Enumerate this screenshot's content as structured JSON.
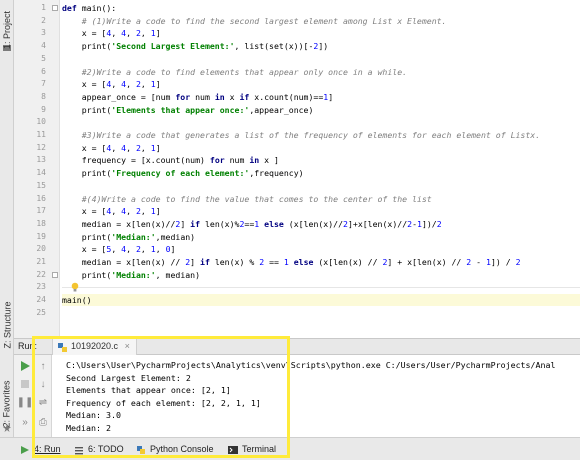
{
  "left_strip": {
    "tab_project": "1: Project",
    "tab_structure": "Z: Structure",
    "tab_favorites": "2: Favorites"
  },
  "editor": {
    "line_numbers": [
      "1",
      "2",
      "3",
      "4",
      "5",
      "6",
      "7",
      "8",
      "9",
      "10",
      "11",
      "12",
      "13",
      "14",
      "15",
      "16",
      "17",
      "18",
      "19",
      "20",
      "21",
      "22",
      "23",
      "24",
      "25"
    ],
    "lines": [
      [
        {
          "t": "def ",
          "c": "kw"
        },
        {
          "t": "main",
          "c": ""
        },
        {
          "t": "():",
          "c": ""
        }
      ],
      [
        {
          "t": "    # (1)Write a code to find the second largest element among List x Element.",
          "c": "cm"
        }
      ],
      [
        {
          "t": "    x = [",
          "c": ""
        },
        {
          "t": "4",
          "c": "num"
        },
        {
          "t": ", ",
          "c": ""
        },
        {
          "t": "4",
          "c": "num"
        },
        {
          "t": ", ",
          "c": ""
        },
        {
          "t": "2",
          "c": "num"
        },
        {
          "t": ", ",
          "c": ""
        },
        {
          "t": "1",
          "c": "num"
        },
        {
          "t": "]",
          "c": ""
        }
      ],
      [
        {
          "t": "    print(",
          "c": ""
        },
        {
          "t": "'Second Largest Element:'",
          "c": "str"
        },
        {
          "t": ", list(set(x))[-",
          "c": ""
        },
        {
          "t": "2",
          "c": "num"
        },
        {
          "t": "])",
          "c": ""
        }
      ],
      [],
      [
        {
          "t": "    #2)Write a code to find elements that appear only once in a while.",
          "c": "cm"
        }
      ],
      [
        {
          "t": "    x = [",
          "c": ""
        },
        {
          "t": "4",
          "c": "num"
        },
        {
          "t": ", ",
          "c": ""
        },
        {
          "t": "4",
          "c": "num"
        },
        {
          "t": ", ",
          "c": ""
        },
        {
          "t": "2",
          "c": "num"
        },
        {
          "t": ", ",
          "c": ""
        },
        {
          "t": "1",
          "c": "num"
        },
        {
          "t": "]",
          "c": ""
        }
      ],
      [
        {
          "t": "    appear_once = [num ",
          "c": ""
        },
        {
          "t": "for ",
          "c": "kw"
        },
        {
          "t": "num ",
          "c": ""
        },
        {
          "t": "in ",
          "c": "kw"
        },
        {
          "t": "x ",
          "c": ""
        },
        {
          "t": "if ",
          "c": "kw"
        },
        {
          "t": "x.count(num)==",
          "c": ""
        },
        {
          "t": "1",
          "c": "num"
        },
        {
          "t": "]",
          "c": ""
        }
      ],
      [
        {
          "t": "    print(",
          "c": ""
        },
        {
          "t": "'Elements that appear once:'",
          "c": "str"
        },
        {
          "t": ",appear_once)",
          "c": ""
        }
      ],
      [],
      [
        {
          "t": "    #3)Write a code that generates a list of the frequency of elements for each element of Listx.",
          "c": "cm"
        }
      ],
      [
        {
          "t": "    x = [",
          "c": ""
        },
        {
          "t": "4",
          "c": "num"
        },
        {
          "t": ", ",
          "c": ""
        },
        {
          "t": "4",
          "c": "num"
        },
        {
          "t": ", ",
          "c": ""
        },
        {
          "t": "2",
          "c": "num"
        },
        {
          "t": ", ",
          "c": ""
        },
        {
          "t": "1",
          "c": "num"
        },
        {
          "t": "]",
          "c": ""
        }
      ],
      [
        {
          "t": "    frequency = [x.count(num) ",
          "c": ""
        },
        {
          "t": "for ",
          "c": "kw"
        },
        {
          "t": "num ",
          "c": ""
        },
        {
          "t": "in ",
          "c": "kw"
        },
        {
          "t": "x ]",
          "c": ""
        }
      ],
      [
        {
          "t": "    print(",
          "c": ""
        },
        {
          "t": "'Frequency of each element:'",
          "c": "str"
        },
        {
          "t": ",frequency)",
          "c": ""
        }
      ],
      [],
      [
        {
          "t": "    #(4)Write a code to find the value that comes to the center of the list",
          "c": "cm"
        }
      ],
      [
        {
          "t": "    x = [",
          "c": ""
        },
        {
          "t": "4",
          "c": "num"
        },
        {
          "t": ", ",
          "c": ""
        },
        {
          "t": "4",
          "c": "num"
        },
        {
          "t": ", ",
          "c": ""
        },
        {
          "t": "2",
          "c": "num"
        },
        {
          "t": ", ",
          "c": ""
        },
        {
          "t": "1",
          "c": "num"
        },
        {
          "t": "]",
          "c": ""
        }
      ],
      [
        {
          "t": "    median = x[len(x)//",
          "c": ""
        },
        {
          "t": "2",
          "c": "num"
        },
        {
          "t": "] ",
          "c": ""
        },
        {
          "t": "if ",
          "c": "kw"
        },
        {
          "t": "len(x)%",
          "c": ""
        },
        {
          "t": "2",
          "c": "num"
        },
        {
          "t": "==",
          "c": ""
        },
        {
          "t": "1 ",
          "c": "num"
        },
        {
          "t": "else ",
          "c": "kw"
        },
        {
          "t": "(x[len(x)//",
          "c": ""
        },
        {
          "t": "2",
          "c": "num"
        },
        {
          "t": "]+x[len(x)//",
          "c": ""
        },
        {
          "t": "2",
          "c": "num"
        },
        {
          "t": "-",
          "c": ""
        },
        {
          "t": "1",
          "c": "num"
        },
        {
          "t": "])/",
          "c": ""
        },
        {
          "t": "2",
          "c": "num"
        }
      ],
      [
        {
          "t": "    print(",
          "c": ""
        },
        {
          "t": "'Median:'",
          "c": "str"
        },
        {
          "t": ",median)",
          "c": ""
        }
      ],
      [
        {
          "t": "    x = [",
          "c": ""
        },
        {
          "t": "5",
          "c": "num"
        },
        {
          "t": ", ",
          "c": ""
        },
        {
          "t": "4",
          "c": "num"
        },
        {
          "t": ", ",
          "c": ""
        },
        {
          "t": "2",
          "c": "num"
        },
        {
          "t": ", ",
          "c": ""
        },
        {
          "t": "1",
          "c": "num"
        },
        {
          "t": ", ",
          "c": ""
        },
        {
          "t": "0",
          "c": "num"
        },
        {
          "t": "]",
          "c": ""
        }
      ],
      [
        {
          "t": "    median = x[len(x) // ",
          "c": ""
        },
        {
          "t": "2",
          "c": "num"
        },
        {
          "t": "] ",
          "c": ""
        },
        {
          "t": "if ",
          "c": "kw"
        },
        {
          "t": "len(x) % ",
          "c": ""
        },
        {
          "t": "2 ",
          "c": "num"
        },
        {
          "t": "== ",
          "c": ""
        },
        {
          "t": "1 ",
          "c": "num"
        },
        {
          "t": "else ",
          "c": "kw"
        },
        {
          "t": "(x[len(x) // ",
          "c": ""
        },
        {
          "t": "2",
          "c": "num"
        },
        {
          "t": "] + x[len(x) // ",
          "c": ""
        },
        {
          "t": "2 ",
          "c": "num"
        },
        {
          "t": "- ",
          "c": ""
        },
        {
          "t": "1",
          "c": "num"
        },
        {
          "t": "]) / ",
          "c": ""
        },
        {
          "t": "2",
          "c": "num"
        }
      ],
      [
        {
          "t": "    print(",
          "c": ""
        },
        {
          "t": "'Median:'",
          "c": "str"
        },
        {
          "t": ", median)",
          "c": ""
        }
      ],
      [],
      [
        {
          "t": "main()",
          "c": ""
        }
      ],
      []
    ]
  },
  "run_panel": {
    "label": "Run:",
    "tab_name": "10192020.c",
    "output": [
      "C:\\Users\\User\\PycharmProjects\\Analytics\\venv\\Scripts\\python.exe C:/Users/User/PycharmProjects/Anal",
      "Second Largest Element: 2",
      "Elements that appear once: [2, 1]",
      "Frequency of each element: [2, 2, 1, 1]",
      "Median: 3.0",
      "Median: 2"
    ]
  },
  "bottom_bar": {
    "run": "4: Run",
    "todo": "6: TODO",
    "python_console": "Python Console",
    "terminal": "Terminal"
  },
  "colors": {
    "highlight": "#ffeb3b",
    "keyword": "#000080",
    "comment": "#808080",
    "string": "#008000",
    "number": "#0000ff"
  }
}
